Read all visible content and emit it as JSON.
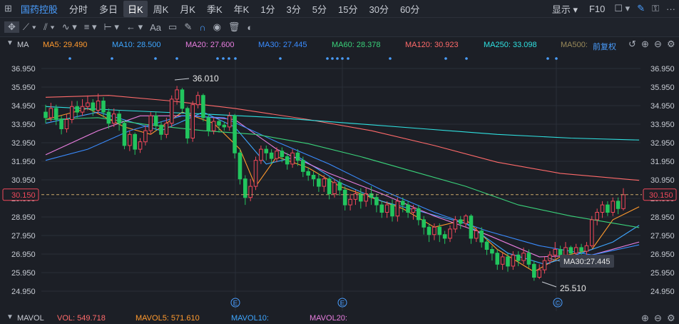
{
  "top_bar": {
    "stock_name": "国药控股",
    "periods": [
      "分时",
      "多日",
      "日K",
      "周K",
      "月K",
      "季K",
      "年K",
      "1分",
      "3分",
      "5分",
      "15分",
      "30分",
      "60分"
    ],
    "active_period": "日K",
    "display_label": "显示",
    "f10_label": "F10"
  },
  "toolbar": {
    "text_tool": "Aa"
  },
  "ma_bar": {
    "label": "MA",
    "items": [
      {
        "text": "MA5: 29.490",
        "color": "#ff9a2e"
      },
      {
        "text": "MA10: 28.500",
        "color": "#3ea6ff"
      },
      {
        "text": "MA20: 27.600",
        "color": "#e97ee0"
      },
      {
        "text": "MA30: 27.445",
        "color": "#3a8cff"
      },
      {
        "text": "MA60: 28.378",
        "color": "#3ad27a"
      },
      {
        "text": "MA120: 30.923",
        "color": "#ff6a6a"
      },
      {
        "text": "MA250: 33.098",
        "color": "#2fe0e0"
      },
      {
        "text": "MA500:",
        "color": "#9a8a5a"
      }
    ],
    "adjust_label": "前复权"
  },
  "vol_bar": {
    "label": "MAVOL",
    "items": [
      {
        "text": "VOL: 549.718",
        "color": "#ff6a6a"
      },
      {
        "text": "MAVOL5: 571.610",
        "color": "#ff9a2e"
      },
      {
        "text": "MAVOL10:",
        "color": "#3ea6ff"
      },
      {
        "text": "MAVOL20:",
        "color": "#e97ee0"
      }
    ]
  },
  "chart_data": {
    "type": "candlestick",
    "y_ticks": [
      "36.950",
      "35.950",
      "34.950",
      "33.950",
      "32.950",
      "31.950",
      "30.950",
      "30.150",
      "29.950",
      "28.950",
      "27.950",
      "26.950",
      "25.950",
      "24.950"
    ],
    "ylim": [
      24.3,
      37.4
    ],
    "current_price": "30.150",
    "annotations": {
      "high": "36.010",
      "low": "25.510",
      "ma_tooltip": "MA30:27.445"
    },
    "event_markers": [
      "E",
      "E",
      "©"
    ],
    "grid": true,
    "colors": {
      "up": "#f0485a",
      "down": "#22c55e",
      "dash": "#c9a86a"
    },
    "candles": [
      [
        34.6,
        34.3,
        35.0,
        34.0
      ],
      [
        34.3,
        34.8,
        35.1,
        34.1
      ],
      [
        34.8,
        34.2,
        35.0,
        33.9
      ],
      [
        34.2,
        33.7,
        34.4,
        33.4
      ],
      [
        33.7,
        34.2,
        34.5,
        33.5
      ],
      [
        34.2,
        34.9,
        35.2,
        34.0
      ],
      [
        34.9,
        34.6,
        35.2,
        34.3
      ],
      [
        34.6,
        34.9,
        35.3,
        34.4
      ],
      [
        34.9,
        35.1,
        35.5,
        34.7
      ],
      [
        35.1,
        34.7,
        35.3,
        34.4
      ],
      [
        34.7,
        35.2,
        35.6,
        34.5
      ],
      [
        35.2,
        34.6,
        35.4,
        34.3
      ],
      [
        34.6,
        34.0,
        34.8,
        33.7
      ],
      [
        34.0,
        34.5,
        34.8,
        33.8
      ],
      [
        34.5,
        34.0,
        34.7,
        33.6
      ],
      [
        34.0,
        32.8,
        34.1,
        32.6
      ],
      [
        32.8,
        33.4,
        33.6,
        32.5
      ],
      [
        33.4,
        32.6,
        33.5,
        32.3
      ],
      [
        32.6,
        33.0,
        33.2,
        32.4
      ],
      [
        33.0,
        33.6,
        33.9,
        32.8
      ],
      [
        33.6,
        34.4,
        34.6,
        33.4
      ],
      [
        34.4,
        33.9,
        34.6,
        33.6
      ],
      [
        33.9,
        33.4,
        34.1,
        33.1
      ],
      [
        33.4,
        34.0,
        34.3,
        33.2
      ],
      [
        34.0,
        35.3,
        35.5,
        33.8
      ],
      [
        35.3,
        35.8,
        36.01,
        35.0
      ],
      [
        35.8,
        34.8,
        35.9,
        34.6
      ],
      [
        34.8,
        33.2,
        34.9,
        32.9
      ],
      [
        33.2,
        35.0,
        35.2,
        33.0
      ],
      [
        35.0,
        35.5,
        35.7,
        34.8
      ],
      [
        35.5,
        34.3,
        35.6,
        34.1
      ],
      [
        34.3,
        33.6,
        34.5,
        33.3
      ],
      [
        33.6,
        34.1,
        34.3,
        33.4
      ],
      [
        34.1,
        33.9,
        34.2,
        33.5
      ],
      [
        33.9,
        33.8,
        34.1,
        33.6
      ],
      [
        33.8,
        34.4,
        34.6,
        33.6
      ],
      [
        34.4,
        32.4,
        34.5,
        32.1
      ],
      [
        32.4,
        31.0,
        32.6,
        30.7
      ],
      [
        31.0,
        30.0,
        31.2,
        29.6
      ],
      [
        30.0,
        30.6,
        31.0,
        29.8
      ],
      [
        30.6,
        32.0,
        32.2,
        30.4
      ],
      [
        32.0,
        32.6,
        32.8,
        31.8
      ],
      [
        32.6,
        32.4,
        32.8,
        32.0
      ],
      [
        32.4,
        32.1,
        32.6,
        31.8
      ],
      [
        32.1,
        32.5,
        32.7,
        31.9
      ],
      [
        32.5,
        32.2,
        32.7,
        31.9
      ],
      [
        32.2,
        31.8,
        32.4,
        31.5
      ],
      [
        31.8,
        32.4,
        32.6,
        31.6
      ],
      [
        32.4,
        32.0,
        32.6,
        31.7
      ],
      [
        32.0,
        31.4,
        32.2,
        31.1
      ],
      [
        31.4,
        31.2,
        31.6,
        30.9
      ],
      [
        31.2,
        31.0,
        31.4,
        30.6
      ],
      [
        31.0,
        30.6,
        31.3,
        30.3
      ],
      [
        30.6,
        31.0,
        31.2,
        30.3
      ],
      [
        31.0,
        30.2,
        31.1,
        29.9
      ],
      [
        30.2,
        30.8,
        31.0,
        30.0
      ],
      [
        30.8,
        30.4,
        31.0,
        30.1
      ],
      [
        30.4,
        29.6,
        30.6,
        29.3
      ],
      [
        29.6,
        29.9,
        30.2,
        29.3
      ],
      [
        29.9,
        30.2,
        30.4,
        29.6
      ],
      [
        30.2,
        29.8,
        30.5,
        29.4
      ],
      [
        29.8,
        30.2,
        30.5,
        29.5
      ],
      [
        30.2,
        30.0,
        30.6,
        29.6
      ],
      [
        30.0,
        29.6,
        30.2,
        29.2
      ],
      [
        29.6,
        29.2,
        29.8,
        28.9
      ],
      [
        29.2,
        29.6,
        29.8,
        28.9
      ],
      [
        29.6,
        29.0,
        29.9,
        28.7
      ],
      [
        29.0,
        29.8,
        30.0,
        28.7
      ],
      [
        29.8,
        29.6,
        30.0,
        29.2
      ],
      [
        29.6,
        29.2,
        29.8,
        28.9
      ],
      [
        29.2,
        29.4,
        29.6,
        28.8
      ],
      [
        29.4,
        28.8,
        29.6,
        28.5
      ],
      [
        28.8,
        28.4,
        29.0,
        28.0
      ],
      [
        28.4,
        28.0,
        28.6,
        27.6
      ],
      [
        28.0,
        28.4,
        28.6,
        27.7
      ],
      [
        28.4,
        28.0,
        28.6,
        27.6
      ],
      [
        28.0,
        27.8,
        28.2,
        27.5
      ],
      [
        27.8,
        28.3,
        28.5,
        27.6
      ],
      [
        28.3,
        28.8,
        29.0,
        28.1
      ],
      [
        28.8,
        28.6,
        29.0,
        28.3
      ],
      [
        28.6,
        29.0,
        29.1,
        28.4
      ],
      [
        29.0,
        27.8,
        29.1,
        27.5
      ],
      [
        27.8,
        28.2,
        28.4,
        27.6
      ],
      [
        28.2,
        27.6,
        28.4,
        27.3
      ],
      [
        27.6,
        27.2,
        27.8,
        26.9
      ],
      [
        27.2,
        27.0,
        27.4,
        26.6
      ],
      [
        27.0,
        26.4,
        27.2,
        26.1
      ],
      [
        26.4,
        26.8,
        27.0,
        26.1
      ],
      [
        26.8,
        26.3,
        27.0,
        26.0
      ],
      [
        26.3,
        26.9,
        27.1,
        26.1
      ],
      [
        26.9,
        26.6,
        27.1,
        26.3
      ],
      [
        26.6,
        27.0,
        27.3,
        26.4
      ],
      [
        27.0,
        26.4,
        27.2,
        26.2
      ],
      [
        26.4,
        25.7,
        26.6,
        25.51
      ],
      [
        25.7,
        26.1,
        26.4,
        25.6
      ],
      [
        26.1,
        26.6,
        26.8,
        25.9
      ],
      [
        26.6,
        26.9,
        27.1,
        26.4
      ],
      [
        26.9,
        27.2,
        27.6,
        26.7
      ],
      [
        27.2,
        26.9,
        27.4,
        26.6
      ],
      [
        26.9,
        27.3,
        27.6,
        26.7
      ],
      [
        27.3,
        27.0,
        27.4,
        26.8
      ],
      [
        27.0,
        27.3,
        27.5,
        26.8
      ],
      [
        27.3,
        27.1,
        27.5,
        26.9
      ],
      [
        27.1,
        27.4,
        27.6,
        26.9
      ],
      [
        27.4,
        28.8,
        29.0,
        27.3
      ],
      [
        28.8,
        29.2,
        29.4,
        28.5
      ],
      [
        29.2,
        29.6,
        29.8,
        28.9
      ],
      [
        29.6,
        29.2,
        29.8,
        29.0
      ],
      [
        29.2,
        29.8,
        30.0,
        29.0
      ],
      [
        29.8,
        29.4,
        30.0,
        29.1
      ],
      [
        29.4,
        30.15,
        30.5,
        29.3
      ]
    ],
    "ma_series": [
      {
        "name": "MA5",
        "color": "#ff9a2e",
        "values": [
          [
            0,
            34.2
          ],
          [
            8,
            34.8
          ],
          [
            15,
            33.8
          ],
          [
            20,
            33.4
          ],
          [
            26,
            34.6
          ],
          [
            32,
            34.0
          ],
          [
            37,
            32.6
          ],
          [
            40,
            30.6
          ],
          [
            44,
            32.2
          ],
          [
            50,
            31.6
          ],
          [
            56,
            30.6
          ],
          [
            62,
            30.0
          ],
          [
            68,
            29.4
          ],
          [
            74,
            28.4
          ],
          [
            80,
            28.8
          ],
          [
            86,
            27.2
          ],
          [
            93,
            26.0
          ],
          [
            98,
            26.8
          ],
          [
            104,
            27.2
          ],
          [
            108,
            28.8
          ],
          [
            113,
            29.5
          ]
        ]
      },
      {
        "name": "MA10",
        "color": "#3ea6ff",
        "values": [
          [
            0,
            34.0
          ],
          [
            10,
            34.6
          ],
          [
            16,
            34.1
          ],
          [
            22,
            33.6
          ],
          [
            30,
            34.6
          ],
          [
            36,
            33.8
          ],
          [
            42,
            31.8
          ],
          [
            48,
            32.2
          ],
          [
            56,
            30.8
          ],
          [
            64,
            29.8
          ],
          [
            72,
            29.2
          ],
          [
            80,
            28.6
          ],
          [
            88,
            27.0
          ],
          [
            95,
            26.4
          ],
          [
            102,
            27.0
          ],
          [
            108,
            27.6
          ],
          [
            113,
            28.5
          ]
        ]
      },
      {
        "name": "MA20",
        "color": "#e97ee0",
        "values": [
          [
            0,
            32.3
          ],
          [
            10,
            33.6
          ],
          [
            18,
            34.4
          ],
          [
            28,
            34.4
          ],
          [
            36,
            34.2
          ],
          [
            44,
            32.6
          ],
          [
            54,
            31.3
          ],
          [
            64,
            30.2
          ],
          [
            74,
            29.0
          ],
          [
            84,
            28.0
          ],
          [
            94,
            26.8
          ],
          [
            104,
            26.9
          ],
          [
            113,
            27.6
          ]
        ]
      },
      {
        "name": "MA30",
        "color": "#3a8cff",
        "values": [
          [
            0,
            32.0
          ],
          [
            8,
            32.6
          ],
          [
            16,
            33.6
          ],
          [
            26,
            34.4
          ],
          [
            34,
            34.3
          ],
          [
            44,
            33.0
          ],
          [
            54,
            31.8
          ],
          [
            64,
            30.4
          ],
          [
            74,
            29.2
          ],
          [
            84,
            28.2
          ],
          [
            94,
            27.4
          ],
          [
            104,
            26.9
          ],
          [
            113,
            27.445
          ]
        ]
      },
      {
        "name": "MA60",
        "color": "#3ad27a",
        "values": [
          [
            0,
            34.2
          ],
          [
            10,
            34.3
          ],
          [
            20,
            33.9
          ],
          [
            30,
            33.6
          ],
          [
            40,
            33.4
          ],
          [
            50,
            32.9
          ],
          [
            60,
            32.2
          ],
          [
            70,
            31.4
          ],
          [
            80,
            30.6
          ],
          [
            90,
            29.6
          ],
          [
            100,
            29.0
          ],
          [
            113,
            28.378
          ]
        ]
      },
      {
        "name": "MA120",
        "color": "#ff6a6a",
        "values": [
          [
            0,
            35.4
          ],
          [
            12,
            35.5
          ],
          [
            24,
            35.2
          ],
          [
            36,
            34.8
          ],
          [
            50,
            34.2
          ],
          [
            62,
            33.6
          ],
          [
            74,
            32.8
          ],
          [
            86,
            31.9
          ],
          [
            98,
            31.3
          ],
          [
            113,
            30.923
          ]
        ]
      },
      {
        "name": "MA250",
        "color": "#2fe0e0",
        "values": [
          [
            0,
            34.9
          ],
          [
            14,
            34.7
          ],
          [
            30,
            34.5
          ],
          [
            44,
            34.3
          ],
          [
            58,
            34.0
          ],
          [
            72,
            33.7
          ],
          [
            86,
            33.4
          ],
          [
            100,
            33.2
          ],
          [
            113,
            33.098
          ]
        ]
      }
    ]
  }
}
